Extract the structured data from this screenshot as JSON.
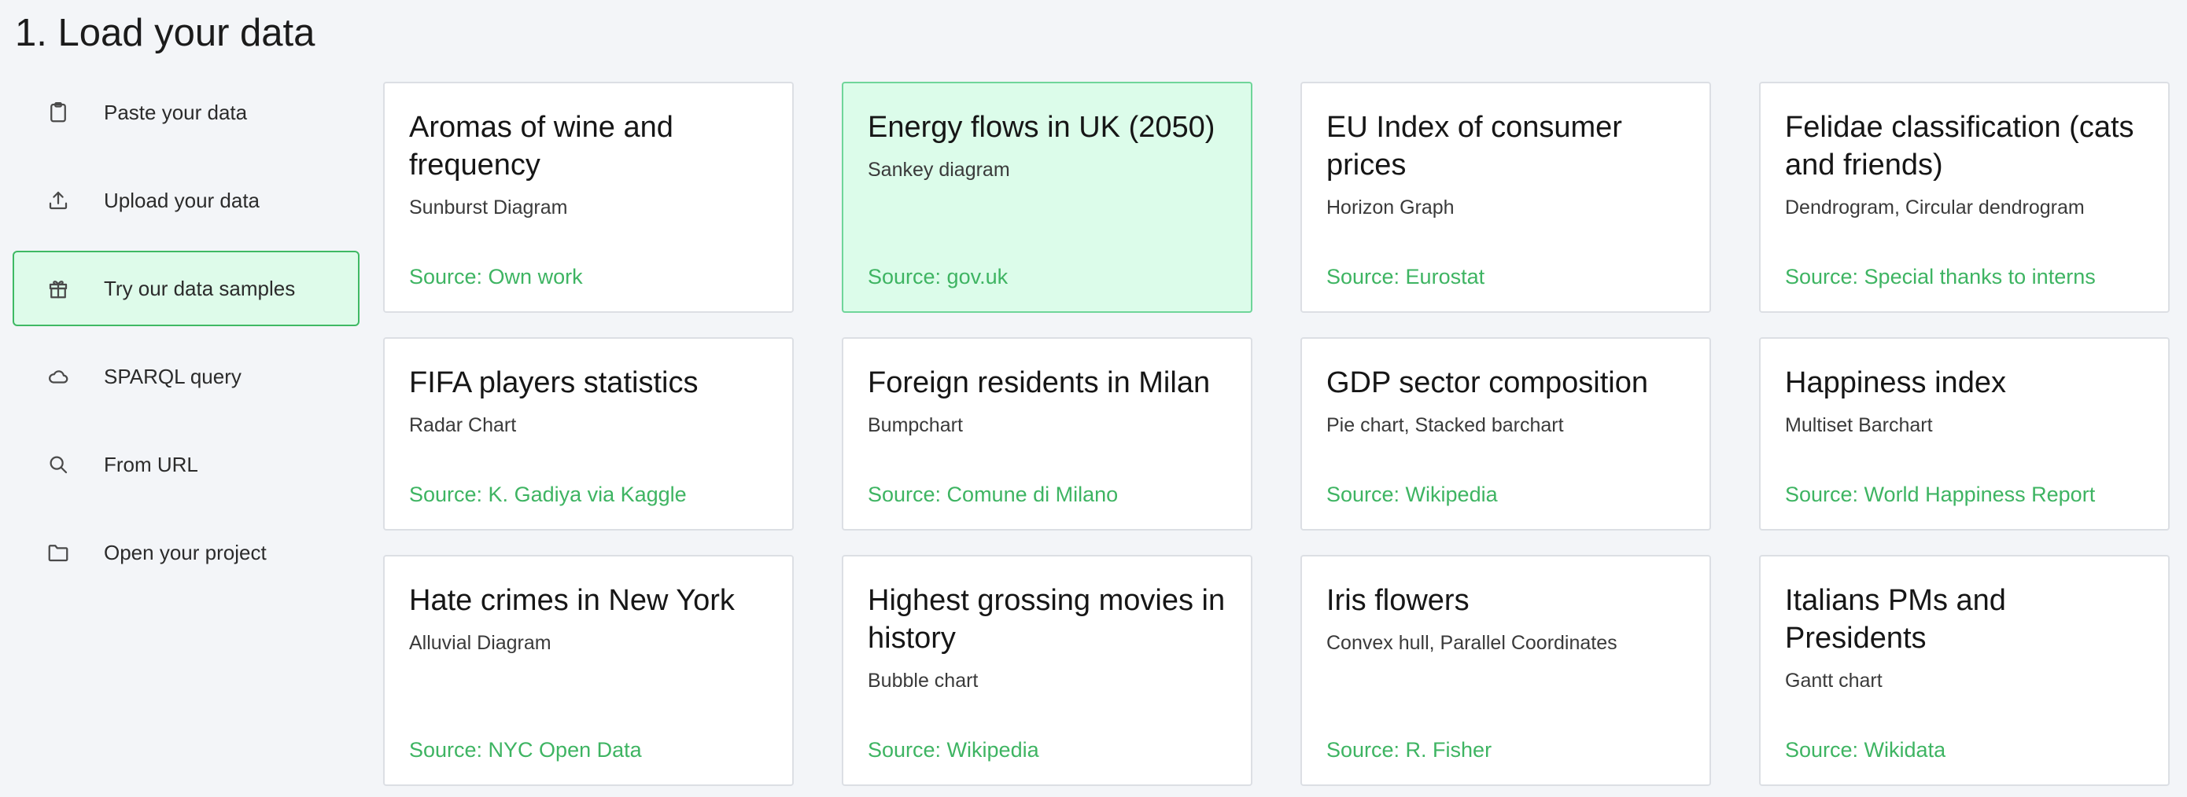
{
  "page_title": "1. Load your data",
  "sidebar": {
    "items": [
      {
        "label": "Paste your data",
        "icon": "clipboard-icon",
        "active": false
      },
      {
        "label": "Upload your data",
        "icon": "upload-icon",
        "active": false
      },
      {
        "label": "Try our data samples",
        "icon": "gift-icon",
        "active": true
      },
      {
        "label": "SPARQL query",
        "icon": "cloud-icon",
        "active": false
      },
      {
        "label": "From URL",
        "icon": "search-icon",
        "active": false
      },
      {
        "label": "Open your project",
        "icon": "folder-icon",
        "active": false
      }
    ]
  },
  "samples": [
    {
      "title": "Aromas of wine and frequency",
      "chart": "Sunburst Diagram",
      "source": "Source: Own work"
    },
    {
      "title": "Energy flows in UK (2050)",
      "chart": "Sankey diagram",
      "source": "Source: gov.uk",
      "highlighted": true
    },
    {
      "title": "EU Index of consumer prices",
      "chart": "Horizon Graph",
      "source": "Source: Eurostat"
    },
    {
      "title": "Felidae classification (cats and friends)",
      "chart": "Dendrogram, Circular dendrogram",
      "source": "Source: Special thanks to interns"
    },
    {
      "title": "FIFA players statistics",
      "chart": "Radar Chart",
      "source": "Source: K. Gadiya via Kaggle"
    },
    {
      "title": "Foreign residents in Milan",
      "chart": "Bumpchart",
      "source": "Source: Comune di Milano"
    },
    {
      "title": "GDP sector composition",
      "chart": "Pie chart, Stacked barchart",
      "source": "Source: Wikipedia"
    },
    {
      "title": "Happiness index",
      "chart": "Multiset Barchart",
      "source": "Source: World Happiness Report"
    },
    {
      "title": "Hate crimes in New York",
      "chart": "Alluvial Diagram",
      "source": "Source: NYC Open Data"
    },
    {
      "title": "Highest grossing movies in history",
      "chart": "Bubble chart",
      "source": "Source: Wikipedia"
    },
    {
      "title": "Iris flowers",
      "chart": "Convex hull, Parallel Coordinates",
      "source": "Source: R. Fisher"
    },
    {
      "title": "Italians PMs and Presidents",
      "chart": "Gantt chart",
      "source": "Source: Wikidata"
    }
  ],
  "colors": {
    "accent": "#3eb462",
    "active_bg": "#defbea",
    "highlight_bg": "#dcfcea"
  }
}
